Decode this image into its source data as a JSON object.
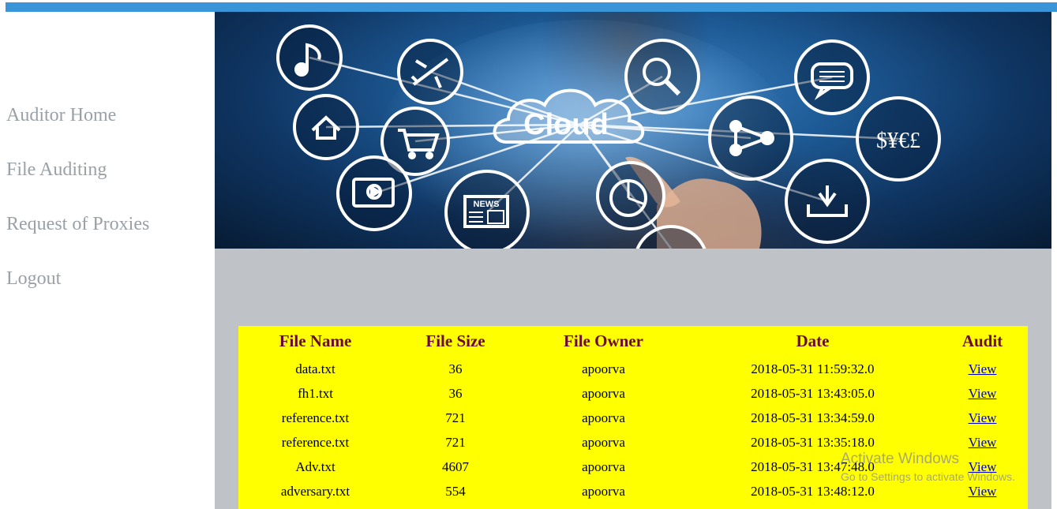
{
  "nav": {
    "items": [
      {
        "label": "Auditor Home"
      },
      {
        "label": "File Auditing"
      },
      {
        "label": "Request of Proxies"
      },
      {
        "label": "Logout"
      }
    ]
  },
  "banner": {
    "cloud_text": "Cloud",
    "news_text": "NEWS",
    "currency_text": "$¥€£",
    "icons": [
      "music-note-icon",
      "airplane-icon",
      "search-icon",
      "chat-icon",
      "home-icon",
      "cart-icon",
      "share-icon",
      "currency-icon",
      "video-icon",
      "news-icon",
      "pie-chart-icon",
      "download-icon"
    ]
  },
  "table": {
    "headers": [
      "File Name",
      "File Size",
      "File Owner",
      "Date",
      "Audit"
    ],
    "rows": [
      [
        "data.txt",
        "36",
        "apoorva",
        "2018-05-31 11:59:32.0",
        "View"
      ],
      [
        "fh1.txt",
        "36",
        "apoorva",
        "2018-05-31 13:43:05.0",
        "View"
      ],
      [
        "reference.txt",
        "721",
        "apoorva",
        "2018-05-31 13:34:59.0",
        "View"
      ],
      [
        "reference.txt",
        "721",
        "apoorva",
        "2018-05-31 13:35:18.0",
        "View"
      ],
      [
        "Adv.txt",
        "4607",
        "apoorva",
        "2018-05-31 13:47:48.0",
        "View"
      ],
      [
        "adversary.txt",
        "554",
        "apoorva",
        "2018-05-31 13:48:12.0",
        "View"
      ]
    ]
  },
  "watermark": {
    "title": "Activate Windows",
    "subtitle": "Go to Settings to activate Windows."
  },
  "colors": {
    "topbar": "#3a94d8",
    "table_bg": "#ffff00",
    "header_text": "#6b0a35",
    "content_bg": "#bfc2c6",
    "nav_text": "#9aa1a6"
  }
}
